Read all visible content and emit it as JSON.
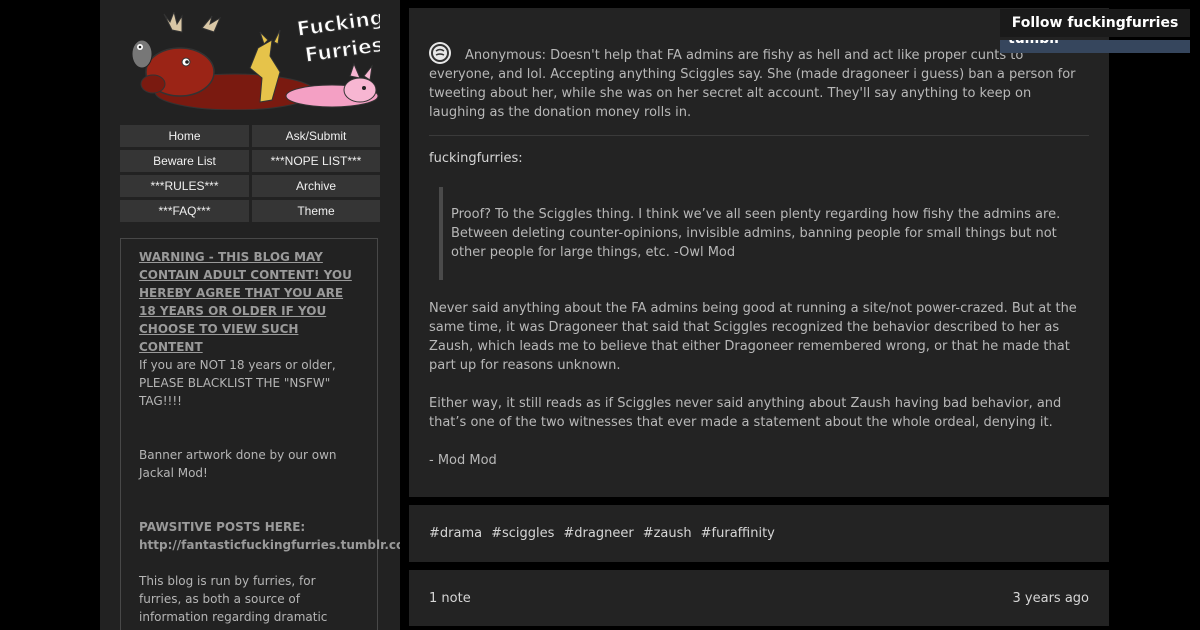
{
  "banner": {
    "logo_line1": "Fucking",
    "logo_line2": "Furries"
  },
  "nav": [
    {
      "label": "Home"
    },
    {
      "label": "Ask/Submit"
    },
    {
      "label": "Beware List"
    },
    {
      "label": "***NOPE LIST***"
    },
    {
      "label": "***RULES***"
    },
    {
      "label": "Archive"
    },
    {
      "label": "***FAQ***"
    },
    {
      "label": "Theme"
    }
  ],
  "description": {
    "warning": "WARNING - THIS BLOG MAY CONTAIN ADULT CONTENT! YOU HEREBY AGREE THAT YOU ARE 18 YEARS OR OLDER IF YOU CHOOSE TO VIEW SUCH CONTENT",
    "nsfw_note": "If you are NOT 18 years or older, PLEASE BLACKLIST THE \"NSFW\" TAG!!!!",
    "banner_credit": "Banner artwork done by our own Jackal Mod!",
    "pawsitive_label": "PAWSITIVE POSTS HERE:",
    "pawsitive_link": "http://fantasticfuckingfurries.tumblr.com",
    "about": "This blog is run by furries, for furries, as both a source of information regarding dramatic"
  },
  "post": {
    "ask_text": "Anonymous: Doesn't help that FA admins are fishy as hell and act like proper cunts to everyone, and lol. Accepting anything Sciggles say. She (made dragoneer i guess) ban a person for tweeting about her, while she was on her secret alt account. They'll say anything to keep on laughing as the donation money rolls in.",
    "answerer": "fuckingfurries",
    "answerer_suffix": ":",
    "quote": "Proof? To the Sciggles thing. I think we’ve all seen plenty regarding how fishy the admins are. Between deleting counter-opinions, invisible admins, banning people for small things but not other people for large things, etc. -Owl Mod",
    "para1": "Never said anything about the FA admins being good at running a site/not power-crazed. But at the same time, it was Dragoneer that said that Sciggles recognized the behavior described to her as Zaush, which leads me to believe that either Dragoneer remembered wrong, or that he made that part up for reasons unknown.",
    "para2": "Either way, it still reads as if Sciggles never said anything about Zaush having bad behavior, and that’s one of the two witnesses that ever made a statement about the whole ordeal, denying it.",
    "signoff": "- Mod Mod"
  },
  "tags": [
    "#drama",
    "#sciggles",
    "#dragneer",
    "#zaush",
    "#furaffinity"
  ],
  "notes": {
    "count": "1 note",
    "time": "3 years ago"
  },
  "follow": {
    "label": "Follow fuckingfurries",
    "tumblr_label": "tumblr"
  },
  "colors": {
    "sidebar_bg": "#222222",
    "panel_bg": "#232323",
    "tumblr_blue": "#36465d"
  }
}
